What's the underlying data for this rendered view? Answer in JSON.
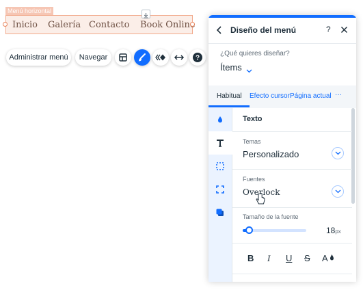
{
  "canvas": {
    "menu_tag": "Menú horizontal",
    "menu_items": [
      {
        "label": "Inicio"
      },
      {
        "label": "Galería"
      },
      {
        "label": "Contacto"
      },
      {
        "label": "Book Online"
      }
    ],
    "download_icon": "download-icon"
  },
  "toolbar": {
    "manage_menu_label": "Administrar menú",
    "navigate_label": "Navegar",
    "icons": [
      "layout-icon",
      "brush-icon",
      "animation-icon",
      "stretch-icon",
      "help-icon"
    ]
  },
  "panel": {
    "title": "Diseño del menú",
    "help_label": "?",
    "question_label": "¿Qué quieres diseñar?",
    "question_value": "Ítems",
    "tabs": [
      {
        "label": "Habitual",
        "active": true
      },
      {
        "label": "Efecto cursor",
        "active": false
      },
      {
        "label": "Página actual",
        "active": false
      },
      {
        "label": "···",
        "active": false
      }
    ],
    "section_title": "Texto",
    "themes_label": "Temas",
    "themes_value": "Personalizado",
    "fonts_label": "Fuentes",
    "fonts_value": "Overlock",
    "font_size_label": "Tamaño de la fuente",
    "font_size_value": "18",
    "font_size_unit": "px",
    "font_size_fraction": 0.1,
    "format_buttons": [
      "B",
      "I",
      "U",
      "S",
      "A"
    ],
    "side_icons": [
      "fill-drop-icon",
      "text-icon",
      "border-icon",
      "corners-icon",
      "shadow-icon"
    ]
  },
  "colors": {
    "accent": "#116dff",
    "selection": "#f2a98b",
    "text": "#20303c"
  }
}
